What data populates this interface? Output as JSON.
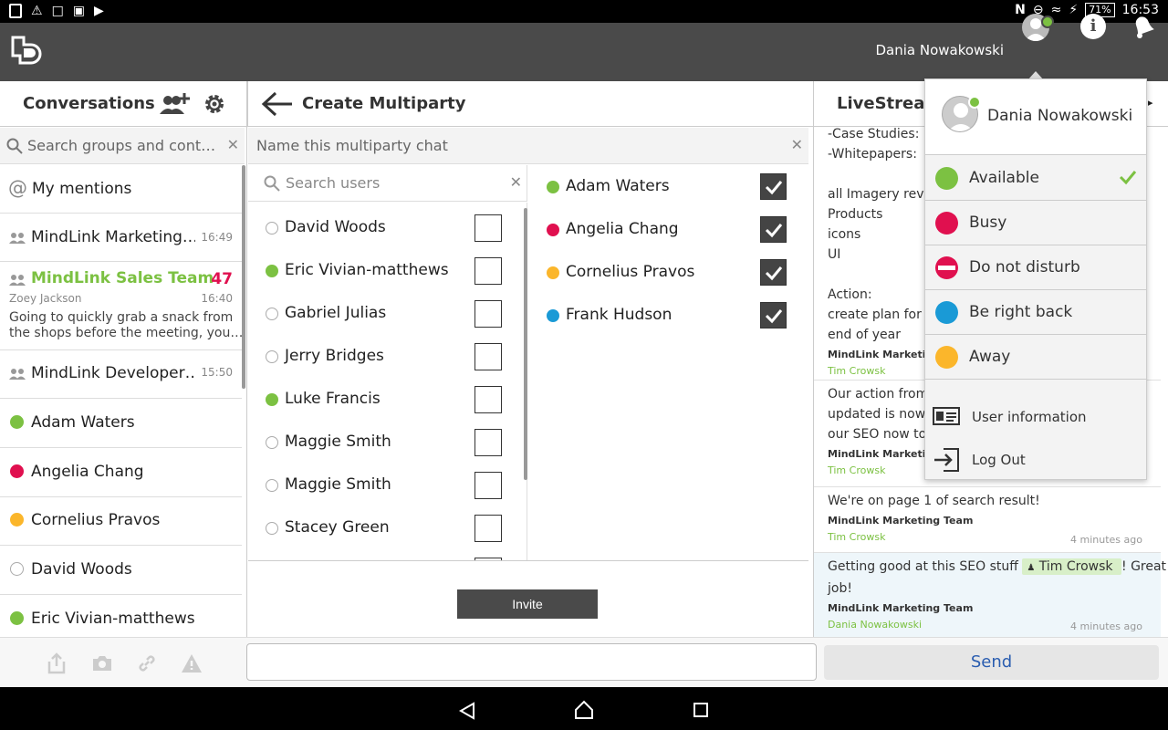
{
  "statusbar": {
    "battery": "71%",
    "time": "16:53"
  },
  "header": {
    "user_name": "Dania Nowakowski"
  },
  "conversations": {
    "title": "Conversations",
    "search_placeholder": "Search groups and cont…",
    "mentions_label": "My mentions",
    "items": [
      {
        "name": "MindLink Marketing…",
        "time": "16:49"
      },
      {
        "name": "MindLink Sales Team",
        "count": "47",
        "sender": "Zoey Jackson",
        "time": "16:40",
        "preview1": "Going to quickly grab a snack from",
        "preview2": "the shops before the meeting, you…"
      },
      {
        "name": "MindLink Developer…",
        "time": "15:50"
      },
      {
        "name": "Adam Waters"
      },
      {
        "name": "Angelia Chang"
      },
      {
        "name": "Cornelius Pravos"
      },
      {
        "name": "David Woods"
      },
      {
        "name": "Eric Vivian-matthews"
      }
    ]
  },
  "multiparty": {
    "title": "Create Multiparty",
    "name_placeholder": "Name this multiparty chat",
    "search_placeholder": "Search users",
    "users": [
      {
        "name": "David Woods",
        "status": "offline"
      },
      {
        "name": "Eric Vivian-matthews",
        "status": "available"
      },
      {
        "name": "Gabriel Julias",
        "status": "offline"
      },
      {
        "name": "Jerry Bridges",
        "status": "offline"
      },
      {
        "name": "Luke Francis",
        "status": "available"
      },
      {
        "name": "Maggie Smith",
        "status": "offline"
      },
      {
        "name": "Maggie Smith",
        "status": "offline"
      },
      {
        "name": "Stacey Green",
        "status": "offline"
      }
    ],
    "selected": [
      {
        "name": "Adam Waters",
        "status": "available"
      },
      {
        "name": "Angelia Chang",
        "status": "busy"
      },
      {
        "name": "Cornelius Pravos",
        "status": "away"
      },
      {
        "name": "Frank Hudson",
        "status": "brb"
      }
    ],
    "invite_label": "Invite"
  },
  "livestream": {
    "title": "LiveStream",
    "block1_lines": [
      "-Case Studies:",
      "-Whitepapers:",
      "",
      "all Imagery revie",
      "Products",
      "icons",
      "UI",
      "",
      "Action:",
      "create plan for C",
      "end of year"
    ],
    "block1_team": "MindLink Marketing",
    "block1_author": "Tim Crowsk",
    "block2_lines": [
      "Our action from",
      "updated is now c",
      "our SEO now to"
    ],
    "block2_team": "MindLink Marketing",
    "block2_author": "Tim Crowsk",
    "block3_line": "We're on page 1 of search result!",
    "block3_team": "MindLink Marketing Team",
    "block3_author": "Tim Crowsk",
    "block3_ago": "4 minutes ago",
    "block4_pre": "Getting good at this SEO stuff",
    "block4_mention": "Tim Crowsk",
    "block4_post": "! Great",
    "block4_line2": "job!",
    "block4_team": "MindLink Marketing Team",
    "block4_author": "Dania Nowakowski",
    "block4_ago": "4 minutes ago"
  },
  "composer": {
    "send_label": "Send"
  },
  "status_menu": {
    "user_name": "Dania Nowakowski",
    "statuses": [
      {
        "label": "Available",
        "color": "#7cc142",
        "selected": true
      },
      {
        "label": "Busy",
        "color": "#e0104f"
      },
      {
        "label": "Do not disturb",
        "color": "#e0104f"
      },
      {
        "label": "Be right back",
        "color": "#1a9ad6"
      },
      {
        "label": "Away",
        "color": "#fbb62b"
      }
    ],
    "user_info_label": "User information",
    "logout_label": "Log Out"
  },
  "colors": {
    "available": "#7cc142",
    "busy": "#e0104f",
    "away": "#fbb62b",
    "brb": "#1a9ad6",
    "header_bg": "#4a4a4a",
    "accent_green": "#7cc142",
    "count_red": "#e0104f"
  }
}
